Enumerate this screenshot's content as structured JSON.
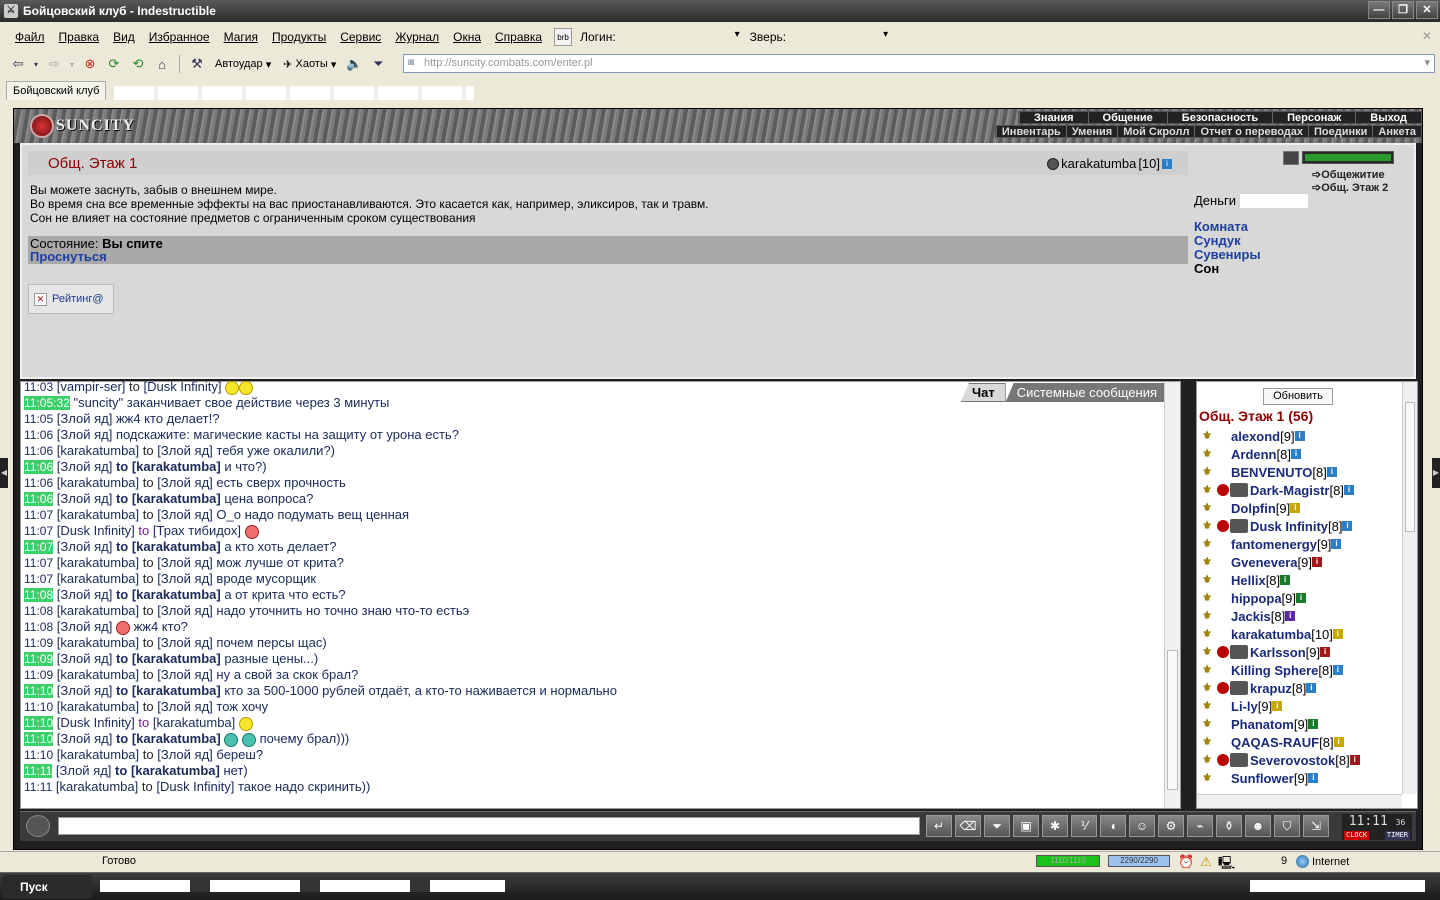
{
  "window": {
    "title": "Бойцовский клуб - Indestructible",
    "btn_min": "—",
    "btn_max": "❐",
    "btn_close": "✕"
  },
  "menu": {
    "items": [
      "Файл",
      "Правка",
      "Вид",
      "Избранное",
      "Магия",
      "Продукты",
      "Сервис",
      "Журнал",
      "Окна",
      "Справка"
    ],
    "brb_label": "brb",
    "login_label": "Логин:",
    "beast_label": "Зверь:"
  },
  "toolbar": {
    "autohit": "Автоудар",
    "chaos": "Хаоты",
    "address": "http://suncity.combats.com/enter.pl"
  },
  "browser_tab": {
    "label": "Бойцовский клуб"
  },
  "game": {
    "logo": "SUNCITY",
    "nav_top": [
      "Знания",
      "Общение",
      "Безопасность",
      "Персонаж",
      "Выход"
    ],
    "nav_bottom": [
      "Инвентарь",
      "Умения",
      "Мой Скролл",
      "Отчет о переводах",
      "Поединки",
      "Анкета"
    ]
  },
  "room": {
    "title": "Общ. Этаж 1",
    "user_name": "karakatumba",
    "user_level": "[10]",
    "desc_lines": [
      "Вы можете заснуть, забыв о внешнем мире.",
      "Во время сна все временные эффекты на вас приостанавливаются. Это касается как, например, эликсиров, так и травм.",
      "Сон не влияет на состояние предметов с ограниченным сроком существования"
    ],
    "state_label": "Состояние:",
    "state_value": "Вы спите",
    "wake_link": "Проснуться",
    "rating_label": "Рейтинг@"
  },
  "right_panel": {
    "locations": [
      "Общежитие",
      "Общ. Этаж 2"
    ],
    "money_label": "Деньги",
    "links": [
      "Комната",
      "Сундук",
      "Сувениры"
    ],
    "current": "Сон"
  },
  "chat": {
    "tabs": [
      "Чат",
      "Системные сообщения"
    ],
    "lines": [
      {
        "time": "11:03",
        "hl": false,
        "from": "[vampir-ser]",
        "to_kind": "to",
        "to": "[Dusk Infinity]",
        "text": "",
        "smile": "yy"
      },
      {
        "time": "11:05:32",
        "hl": true,
        "from": "\"suncity\"",
        "to_kind": "",
        "to": "",
        "text": "заканчивает свое действие через 3 минуты",
        "smile": ""
      },
      {
        "time": "11:05",
        "hl": false,
        "from": "[Злой яд]",
        "to_kind": "",
        "to": "",
        "text": "жж4 кто делает!?",
        "smile": ""
      },
      {
        "time": "11:06",
        "hl": false,
        "from": "[Злой яд]",
        "to_kind": "",
        "to": "",
        "text": "подскажите: магические касты на защиту от урона есть?",
        "smile": ""
      },
      {
        "time": "11:06",
        "hl": false,
        "from": "[karakatumba]",
        "to_kind": "to",
        "to": "[Злой яд]",
        "text": "тебя уже окалили?)",
        "smile": ""
      },
      {
        "time": "11:06",
        "hl": true,
        "from": "[Злой яд]",
        "to_kind": "to_b",
        "to": "[karakatumba]",
        "text": "и что?)",
        "smile": ""
      },
      {
        "time": "11:06",
        "hl": false,
        "from": "[karakatumba]",
        "to_kind": "to",
        "to": "[Злой яд]",
        "text": "есть сверх прочность",
        "smile": ""
      },
      {
        "time": "11:06",
        "hl": true,
        "from": "[Злой яд]",
        "to_kind": "to_b",
        "to": "[karakatumba]",
        "text": "цена вопроса?",
        "smile": ""
      },
      {
        "time": "11:07",
        "hl": false,
        "from": "[karakatumba]",
        "to_kind": "to",
        "to": "[Злой яд]",
        "text": "О_о надо подумать вещ ценная",
        "smile": ""
      },
      {
        "time": "11:07",
        "hl": false,
        "from": "[Dusk Infinity]",
        "to_kind": "to_p",
        "to": "[Трах тибидох]",
        "text": "",
        "smile": "r"
      },
      {
        "time": "11:07",
        "hl": true,
        "from": "[Злой яд]",
        "to_kind": "to_b",
        "to": "[karakatumba]",
        "text": "а кто хоть делает?",
        "smile": ""
      },
      {
        "time": "11:07",
        "hl": false,
        "from": "[karakatumba]",
        "to_kind": "to",
        "to": "[Злой яд]",
        "text": "мож лучше от крита?",
        "smile": ""
      },
      {
        "time": "11:07",
        "hl": false,
        "from": "[karakatumba]",
        "to_kind": "to",
        "to": "[Злой яд]",
        "text": "вроде мусорщик",
        "smile": ""
      },
      {
        "time": "11:08",
        "hl": true,
        "from": "[Злой яд]",
        "to_kind": "to_b",
        "to": "[karakatumba]",
        "text": "а от крита что есть?",
        "smile": ""
      },
      {
        "time": "11:08",
        "hl": false,
        "from": "[karakatumba]",
        "to_kind": "to",
        "to": "[Злой яд]",
        "text": "надо уточнить но точно знаю что-то естьэ",
        "smile": ""
      },
      {
        "time": "11:08",
        "hl": false,
        "from": "[Злой яд]",
        "to_kind": "",
        "to": "",
        "text": "жж4 кто?",
        "smile": "y"
      },
      {
        "time": "11:09",
        "hl": false,
        "from": "[karakatumba]",
        "to_kind": "to",
        "to": "[Злой яд]",
        "text": "почем персы щас)",
        "smile": ""
      },
      {
        "time": "11:09",
        "hl": true,
        "from": "[Злой яд]",
        "to_kind": "to_b",
        "to": "[karakatumba]",
        "text": "разные цены...)",
        "smile": ""
      },
      {
        "time": "11:09",
        "hl": false,
        "from": "[karakatumba]",
        "to_kind": "to",
        "to": "[Злой яд]",
        "text": "ну а свой за скок брал?",
        "smile": ""
      },
      {
        "time": "11:10",
        "hl": true,
        "from": "[Злой яд]",
        "to_kind": "to_b",
        "to": "[karakatumba]",
        "text": "кто за 500-1000 рублей отдаёт, а кто-то наживается и нормально",
        "smile": ""
      },
      {
        "time": "11:10",
        "hl": false,
        "from": "[karakatumba]",
        "to_kind": "to",
        "to": "[Злой яд]",
        "text": "тож хочу",
        "smile": ""
      },
      {
        "time": "11:10",
        "hl": true,
        "from": "[Dusk Infinity]",
        "to_kind": "to_p",
        "to": "[karakatumba]",
        "text": "",
        "smile": "y"
      },
      {
        "time": "11:10",
        "hl": true,
        "from": "[Злой яд]",
        "to_kind": "to_b",
        "to": "[karakatumba]",
        "text": "почему брал)))",
        "smile": "gg"
      },
      {
        "time": "11:10",
        "hl": false,
        "from": "[karakatumba]",
        "to_kind": "to",
        "to": "[Злой яд]",
        "text": "береш?",
        "smile": ""
      },
      {
        "time": "11:11",
        "hl": true,
        "from": "[Злой яд]",
        "to_kind": "to_b",
        "to": "[karakatumba]",
        "text": "нет)",
        "smile": ""
      },
      {
        "time": "11:11",
        "hl": false,
        "from": "[karakatumba]",
        "to_kind": "to",
        "to": "[Dusk Infinity]",
        "text": "такое надо скринить))",
        "smile": ""
      }
    ],
    "to_word": "to"
  },
  "online": {
    "refresh": "Обновить",
    "title": "Общ. Этаж 1 (56)",
    "users": [
      {
        "name": "alexond",
        "lvl": "[9]",
        "badge": "b",
        "clan": false
      },
      {
        "name": "Ardenn",
        "lvl": "[8]",
        "badge": "b",
        "clan": false
      },
      {
        "name": "BENVENUTO",
        "lvl": "[8]",
        "badge": "b",
        "clan": false
      },
      {
        "name": "Dark-Magistr",
        "lvl": "[8]",
        "badge": "b",
        "clan": true
      },
      {
        "name": "Dolpfin",
        "lvl": "[9]",
        "badge": "y",
        "clan": false
      },
      {
        "name": "Dusk Infinity",
        "lvl": "[8]",
        "badge": "b",
        "clan": true
      },
      {
        "name": "fantomenergy",
        "lvl": "[9]",
        "badge": "b",
        "clan": false
      },
      {
        "name": "Gvenevera",
        "lvl": "[9]",
        "badge": "r",
        "clan": false
      },
      {
        "name": "Hellix",
        "lvl": "[8]",
        "badge": "g",
        "clan": false
      },
      {
        "name": "hippopa",
        "lvl": "[9]",
        "badge": "g",
        "clan": false
      },
      {
        "name": "Jackis",
        "lvl": "[8]",
        "badge": "p",
        "clan": false
      },
      {
        "name": "karakatumba",
        "lvl": "[10]",
        "badge": "y",
        "clan": false
      },
      {
        "name": "Karlsson",
        "lvl": "[9]",
        "badge": "r",
        "clan": true
      },
      {
        "name": "Killing Sphere",
        "lvl": "[8]",
        "badge": "b",
        "clan": false
      },
      {
        "name": "krapuz",
        "lvl": "[8]",
        "badge": "b",
        "clan": true
      },
      {
        "name": "Li-ly",
        "lvl": "[9]",
        "badge": "y",
        "clan": false
      },
      {
        "name": "Phanatom",
        "lvl": "[9]",
        "badge": "g",
        "clan": false
      },
      {
        "name": "QAQAS-RAUF",
        "lvl": "[8]",
        "badge": "y",
        "clan": false
      },
      {
        "name": "Severovostok",
        "lvl": "[8]",
        "badge": "r",
        "clan": true
      },
      {
        "name": "Sunflower",
        "lvl": "[9]",
        "badge": "b",
        "clan": false
      }
    ]
  },
  "clock": {
    "time": "11:11",
    "sec": "36",
    "clock_label": "CLOCK",
    "timer_label": "TIMER"
  },
  "statusbar": {
    "status": "Готово",
    "hp": "1110/1110",
    "mp": "2290/2290",
    "count": "9",
    "zone": "Internet"
  },
  "taskbar": {
    "start": "Пуск"
  }
}
